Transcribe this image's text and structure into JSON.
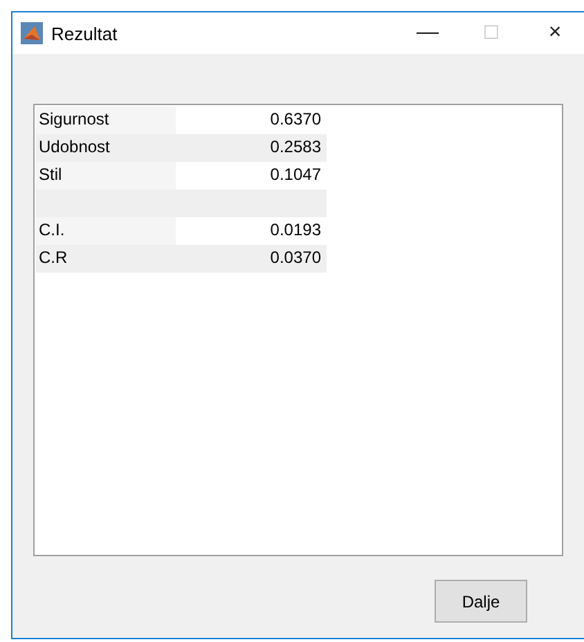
{
  "window": {
    "title": "Rezultat",
    "controls": [
      "—",
      "□",
      "×"
    ]
  },
  "table": {
    "rows": [
      {
        "kind": "data",
        "label": "Sigurnost",
        "value": "0.6370"
      },
      {
        "kind": "data",
        "label": "Udobnost",
        "value": "0.2583"
      },
      {
        "kind": "data",
        "label": "Stil",
        "value": "0.1047"
      },
      {
        "kind": "blank"
      },
      {
        "kind": "data",
        "label": "C.I.",
        "value": "0.0193"
      },
      {
        "kind": "data",
        "label": "C.R",
        "value": "0.0370"
      }
    ]
  },
  "buttons": [
    "Dalje"
  ]
}
